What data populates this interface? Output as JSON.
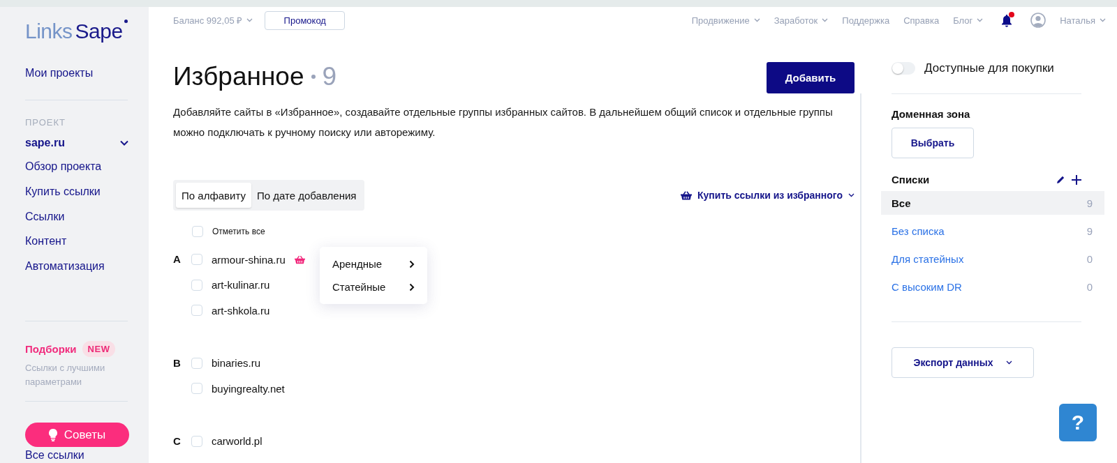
{
  "logo": {
    "part_1": "Links",
    "part_2": "Sape"
  },
  "sidebar": {
    "top_items": [
      {
        "label": "Мои проекты"
      }
    ],
    "section_label": "ПРОЕКТ",
    "project": {
      "label": "sape.ru",
      "expanded": true
    },
    "project_items": [
      {
        "label": "Обзор проекта"
      },
      {
        "label": "Купить ссылки"
      },
      {
        "label": "Ссылки"
      },
      {
        "label": "Контент"
      },
      {
        "label": "Автоматизация"
      }
    ],
    "promo": {
      "title": "Подборки",
      "badge": "NEW",
      "description": "Ссылки с лучшими параметрами"
    },
    "tips_button": "Советы",
    "bottom_items": [
      {
        "label": "Все ссылки"
      }
    ]
  },
  "topbar": {
    "balance": "Баланс 992,05 ₽",
    "promo_button": "Промокод",
    "nav": [
      {
        "label": "Продвижение",
        "dropdown": true
      },
      {
        "label": "Заработок",
        "dropdown": true
      },
      {
        "label": "Поддержка",
        "dropdown": false
      },
      {
        "label": "Справка",
        "dropdown": false
      },
      {
        "label": "Блог",
        "dropdown": true
      }
    ],
    "unread_notifications": true,
    "user": "Наталья"
  },
  "page": {
    "title": "Избранное",
    "count": "9",
    "add_button": "Добавить",
    "description": "Добавляйте сайты в «Избранное», создавайте отдельные группы избранных сайтов. В дальнейшем общий список и отдельные группы можно подключать к ручному поиску или авторежиму.",
    "sort_tabs": [
      {
        "label": "По алфавиту",
        "selected": true
      },
      {
        "label": "По дате добавления",
        "selected": false
      }
    ],
    "buy_menu": "Купить ссылки из избранного",
    "select_all": {
      "label": "Отметить все",
      "checked": false
    },
    "groups": [
      {
        "letter": "A",
        "sites": [
          {
            "domain": "armour-shina.ru",
            "checked": false,
            "in_cart": true
          },
          {
            "domain": "art-kulinar.ru",
            "checked": false,
            "in_cart": false
          },
          {
            "domain": "art-shkola.ru",
            "checked": false,
            "in_cart": false
          }
        ]
      },
      {
        "letter": "B",
        "sites": [
          {
            "domain": "binaries.ru",
            "checked": false,
            "in_cart": false
          },
          {
            "domain": "buyingrealty.net",
            "checked": false,
            "in_cart": false
          }
        ]
      },
      {
        "letter": "C",
        "sites": [
          {
            "domain": "carworld.pl",
            "checked": false,
            "in_cart": false
          }
        ]
      }
    ],
    "context_menu": [
      {
        "label": "Арендные"
      },
      {
        "label": "Статейные"
      }
    ]
  },
  "right_panel": {
    "available_toggle": {
      "label": "Доступные для покупки",
      "on": false
    },
    "domain_zone": {
      "title": "Доменная зона",
      "button": "Выбрать"
    },
    "lists": {
      "title": "Списки",
      "items": [
        {
          "label": "Все",
          "count": "9",
          "selected": true
        },
        {
          "label": "Без списка",
          "count": "9",
          "selected": false
        },
        {
          "label": "Для статейных",
          "count": "0",
          "selected": false
        },
        {
          "label": "С высоким DR",
          "count": "0",
          "selected": false
        }
      ]
    },
    "export_button": "Экспорт данных"
  },
  "help_button": "?"
}
